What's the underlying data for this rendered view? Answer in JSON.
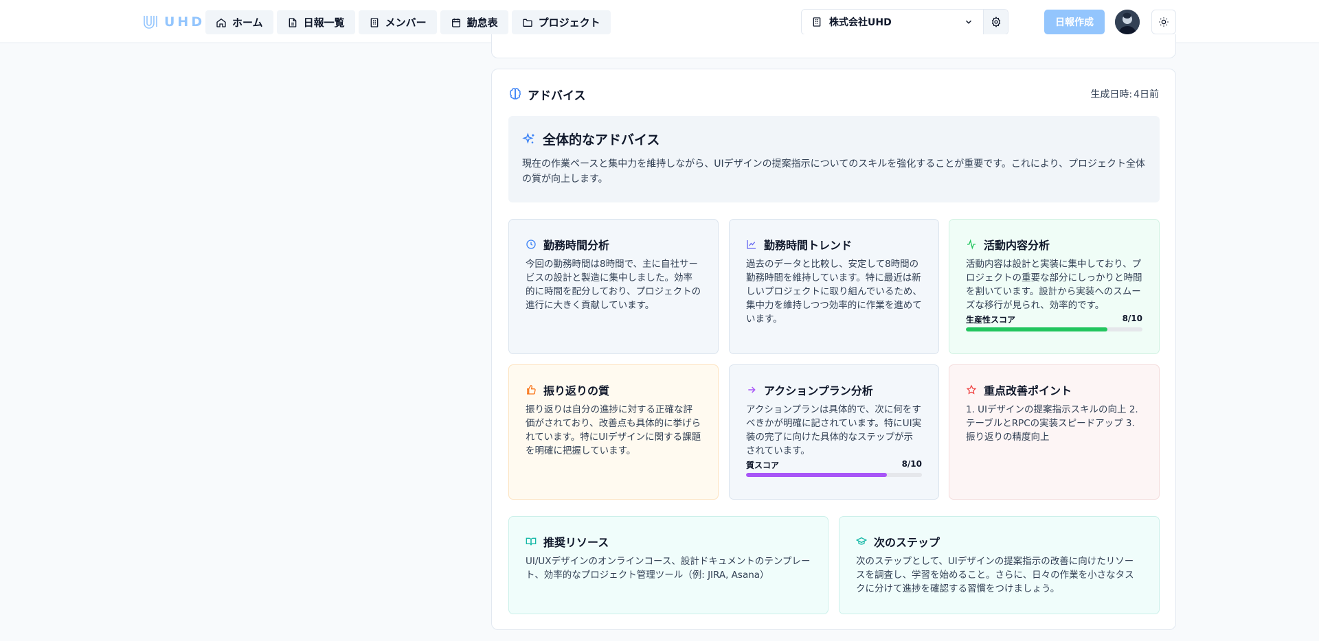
{
  "header": {
    "logo_text": "UHD",
    "nav": [
      {
        "label": "ホーム",
        "icon": "home-icon"
      },
      {
        "label": "日報一覧",
        "icon": "document-icon"
      },
      {
        "label": "メンバー",
        "icon": "building-icon"
      },
      {
        "label": "勤怠表",
        "icon": "calendar-icon"
      },
      {
        "label": "プロジェクト",
        "icon": "folder-icon"
      }
    ],
    "company": "株式会社UHD",
    "create_button": "日報作成"
  },
  "advice": {
    "title": "アドバイス",
    "generated_label": "生成日時:",
    "generated_value": "4日前",
    "overall": {
      "title": "全体的なアドバイス",
      "text": "現在の作業ペースと集中力を維持しながら、UIデザインの提案指示についてのスキルを強化することが重要です。これにより、プロジェクト全体の質が向上します。"
    },
    "sections": {
      "work_time": {
        "title": "勤務時間分析",
        "text": "今回の勤務時間は8時間で、主に自社サービスの設計と製造に集中しました。効率的に時間を配分しており、プロジェクトの進行に大きく貢献しています。"
      },
      "trend": {
        "title": "勤務時間トレンド",
        "text": "過去のデータと比較し、安定して8時間の勤務時間を維持しています。特に最近は新しいプロジェクトに取り組んでいるため、集中力を維持しつつ効率的に作業を進めています。"
      },
      "activity": {
        "title": "活動内容分析",
        "text": "活動内容は設計と実装に集中しており、プロジェクトの重要な部分にしっかりと時間を割いています。設計から実装へのスムーズな移行が見られ、効率的です。",
        "score_label": "生産性スコア",
        "score_text": "8/10",
        "score_fraction": 0.8
      },
      "reflection": {
        "title": "振り返りの質",
        "text": "振り返りは自分の進捗に対する正確な評価がされており、改善点も具体的に挙げられています。特にUIデザインに関する課題を明確に把握しています。"
      },
      "action_plan": {
        "title": "アクションプラン分析",
        "text": "アクションプランは具体的で、次に何をすべきかが明確に記されています。特にUI実装の完了に向けた具体的なステップが示されています。",
        "score_label": "質スコア",
        "score_text": "8/10",
        "score_fraction": 0.8
      },
      "improvement": {
        "title": "重点改善ポイント",
        "text": "1. UIデザインの提案指示スキルの向上 2. テーブルとRPCの実装スピードアップ 3. 振り返りの精度向上"
      },
      "resources": {
        "title": "推奨リソース",
        "text": "UI/UXデザインのオンラインコース、設計ドキュメントのテンプレート、効率的なプロジェクト管理ツール（例: JIRA, Asana）"
      },
      "next_steps": {
        "title": "次のステップ",
        "text": "次のステップとして、UIデザインの提案指示の改善に向けたリソースを調査し、学習を始めること。さらに、日々の作業を小さなタスクに分けて進捗を確認する習慣をつけましょう。"
      }
    }
  },
  "colors": {
    "brand": "#93c5fd",
    "productivity_bar": "#22c55e",
    "quality_bar": "#a855f7",
    "clock_icon": "#3b82f6",
    "trend_icon": "#6366f1",
    "activity_icon": "#22c55e",
    "thumb_icon": "#f97316",
    "arrow_icon": "#a855f7",
    "star_icon": "#ef4444",
    "teal_icon": "#14b8a6"
  }
}
